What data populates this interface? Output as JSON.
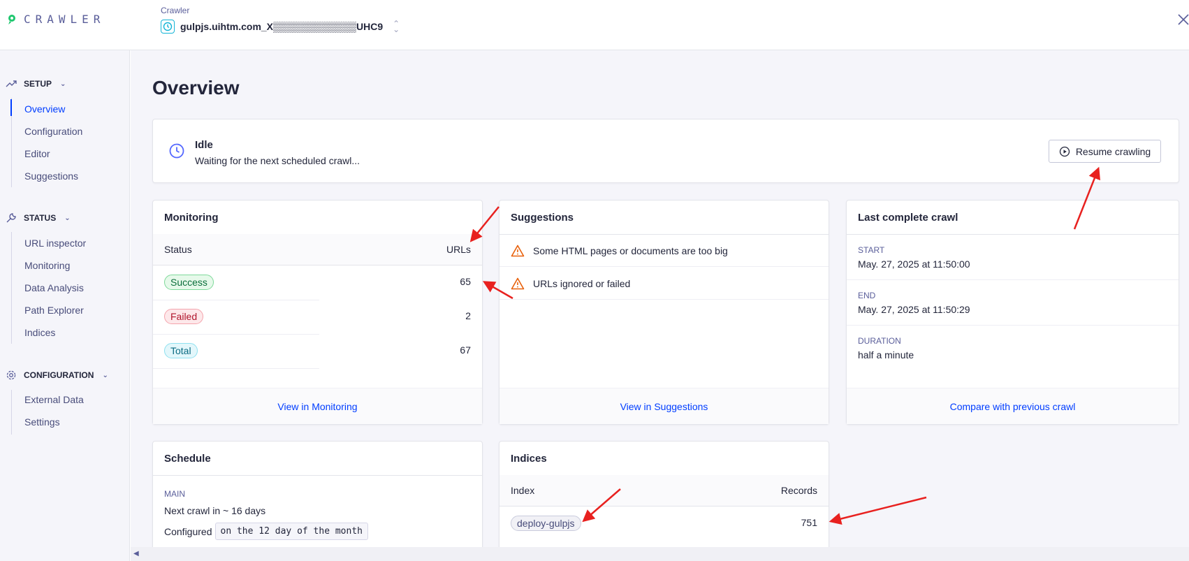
{
  "app": {
    "logo_text": "CRAWLER"
  },
  "crawler": {
    "label": "Crawler",
    "name": "gulpjs.uihtm.com_X▒▒▒▒▒▒▒▒▒▒▒▒UHC9"
  },
  "sidebar": {
    "setup": {
      "title": "SETUP",
      "items": [
        "Overview",
        "Configuration",
        "Editor",
        "Suggestions"
      ],
      "active": "Overview"
    },
    "status": {
      "title": "STATUS",
      "items": [
        "URL inspector",
        "Monitoring",
        "Data Analysis",
        "Path Explorer",
        "Indices"
      ]
    },
    "configuration": {
      "title": "CONFIGURATION",
      "items": [
        "External Data",
        "Settings"
      ]
    }
  },
  "page": {
    "title": "Overview"
  },
  "idle": {
    "title": "Idle",
    "subtitle": "Waiting for the next scheduled crawl...",
    "resume_label": "Resume crawling"
  },
  "monitoring": {
    "title": "Monitoring",
    "col_status": "Status",
    "col_urls": "URLs",
    "rows": [
      {
        "status": "Success",
        "count": "65"
      },
      {
        "status": "Failed",
        "count": "2"
      },
      {
        "status": "Total",
        "count": "67"
      }
    ],
    "footer_link": "View in Monitoring"
  },
  "suggestions": {
    "title": "Suggestions",
    "items": [
      "Some HTML pages or documents are too big",
      "URLs ignored or failed"
    ],
    "footer_link": "View in Suggestions"
  },
  "last_crawl": {
    "title": "Last complete crawl",
    "start_label": "START",
    "start": "May. 27, 2025 at 11:50:00",
    "end_label": "END",
    "end": "May. 27, 2025 at 11:50:29",
    "duration_label": "DURATION",
    "duration": "half a minute",
    "footer_link": "Compare with previous crawl"
  },
  "schedule": {
    "title": "Schedule",
    "label": "MAIN",
    "next": "Next crawl in ~ 16 days",
    "configured_label": "Configured",
    "configured_value": "on the 12 day of the month"
  },
  "indices": {
    "title": "Indices",
    "col_index": "Index",
    "col_records": "Records",
    "rows": [
      {
        "name": "deploy-gulpjs",
        "records": "751"
      }
    ]
  },
  "colors": {
    "accent": "#003dff",
    "warning": "#e8600a",
    "annotation": "#e8211f"
  }
}
